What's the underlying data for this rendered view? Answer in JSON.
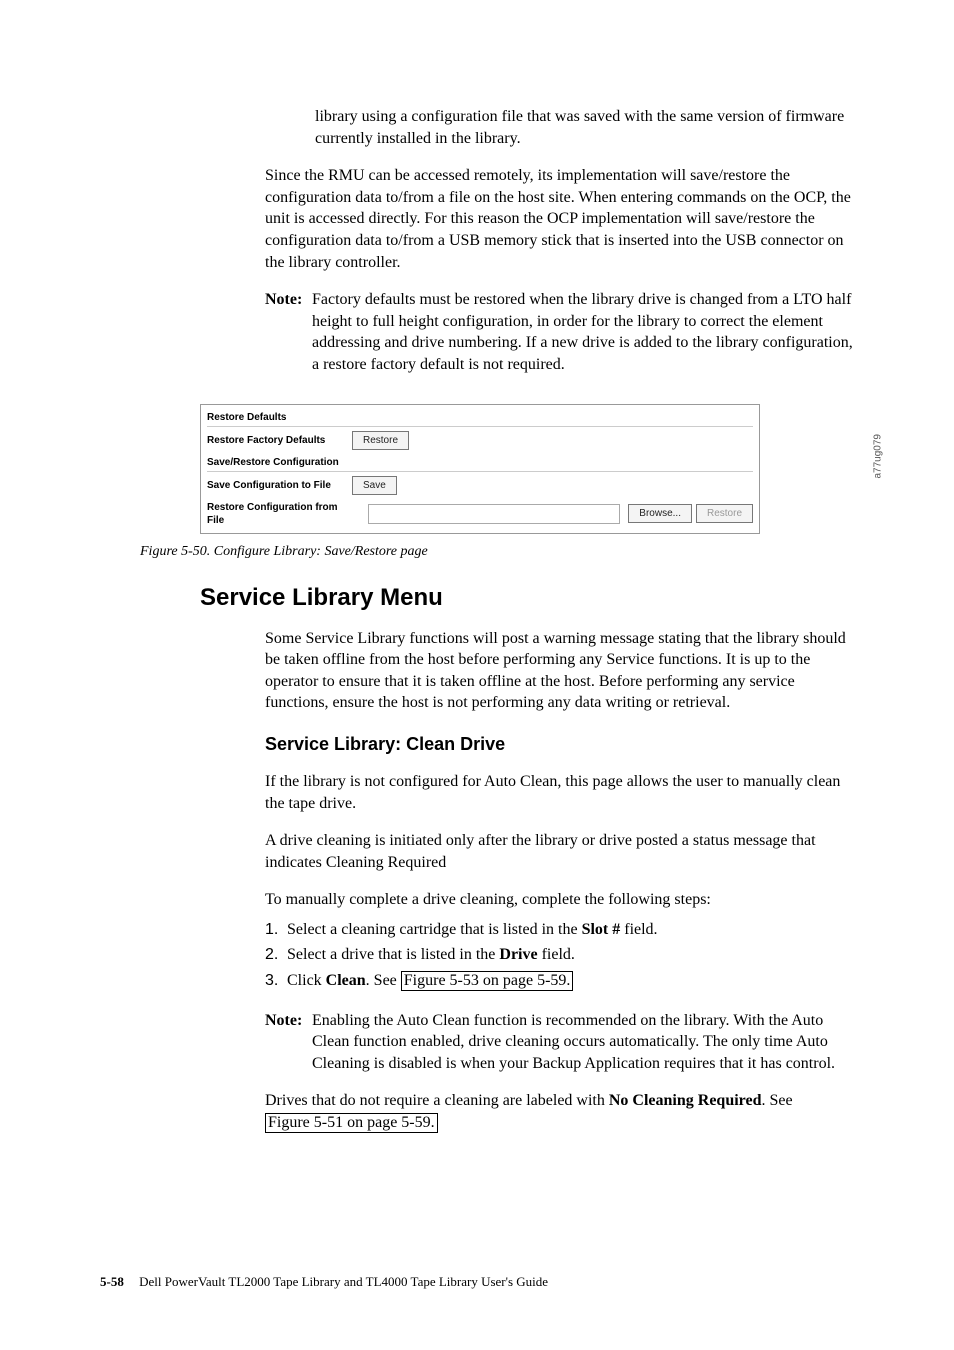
{
  "intro": {
    "p1": "library using a configuration file that was saved with the same version of firmware currently installed in the library.",
    "p2": "Since the RMU can be accessed remotely, its implementation will save/restore the configuration data to/from a file on the host site. When entering commands on the OCP, the unit is accessed directly. For this reason the OCP implementation will save/restore the configuration data to/from a USB memory stick that is inserted into the USB connector on the library controller.",
    "note_label": "Note:",
    "note_text": "Factory defaults must be restored when the library drive is changed from a LTO half height to full height configuration, in order for the library to correct the element addressing and drive numbering. If a new drive is added to the library configuration, a restore factory default is not required."
  },
  "app": {
    "section1_title": "Restore Defaults",
    "row1_label": "Restore Factory Defaults",
    "restore_btn": "Restore",
    "section2_title": "Save/Restore Configuration",
    "row2_label": "Save Configuration to File",
    "save_btn": "Save",
    "row3_label": "Restore Configuration from File",
    "browse_btn": "Browse...",
    "restore2_btn": "Restore",
    "sidetag": "a77ug079"
  },
  "figure_caption": "Figure 5-50. Configure Library: Save/Restore page",
  "service": {
    "h1": "Service Library Menu",
    "p1": "Some Service Library functions will post a warning message stating that the library should be taken offline from the host before performing any Service functions. It is up to the operator to ensure that it is taken offline at the host. Before performing any service functions, ensure the host is not performing any data writing or retrieval.",
    "h2": "Service Library: Clean Drive",
    "p2": "If the library is not configured for Auto Clean, this page allows the user to manually clean the tape drive.",
    "p3": "A drive cleaning is initiated only after the library or drive posted a status message that indicates Cleaning Required",
    "p4": "To manually complete a drive cleaning, complete the following steps:",
    "step1_a": "Select a cleaning cartridge that is listed in the ",
    "step1_b": "Slot #",
    "step1_c": " field.",
    "step2_a": "Select a drive that is listed in the ",
    "step2_b": "Drive",
    "step2_c": " field.",
    "step3_a": "Click ",
    "step3_b": "Clean",
    "step3_c": ". See ",
    "step3_link": "Figure 5-53 on page 5-59.",
    "note_label": "Note:",
    "note_text": "Enabling the Auto Clean function is recommended on the library. With the Auto Clean function enabled, drive cleaning occurs automatically. The only time Auto Cleaning is disabled is when your Backup Application requires that it has control.",
    "p5_a": "Drives that do not require a cleaning are labeled with ",
    "p5_b": "No Cleaning Required",
    "p5_c": ". See ",
    "p5_link": "Figure 5-51 on page 5-59."
  },
  "footer": {
    "pagenum": "5-58",
    "title": "Dell PowerVault TL2000 Tape Library and TL4000 Tape Library User's Guide"
  },
  "ords": {
    "n1": "1.",
    "n2": "2.",
    "n3": "3."
  }
}
